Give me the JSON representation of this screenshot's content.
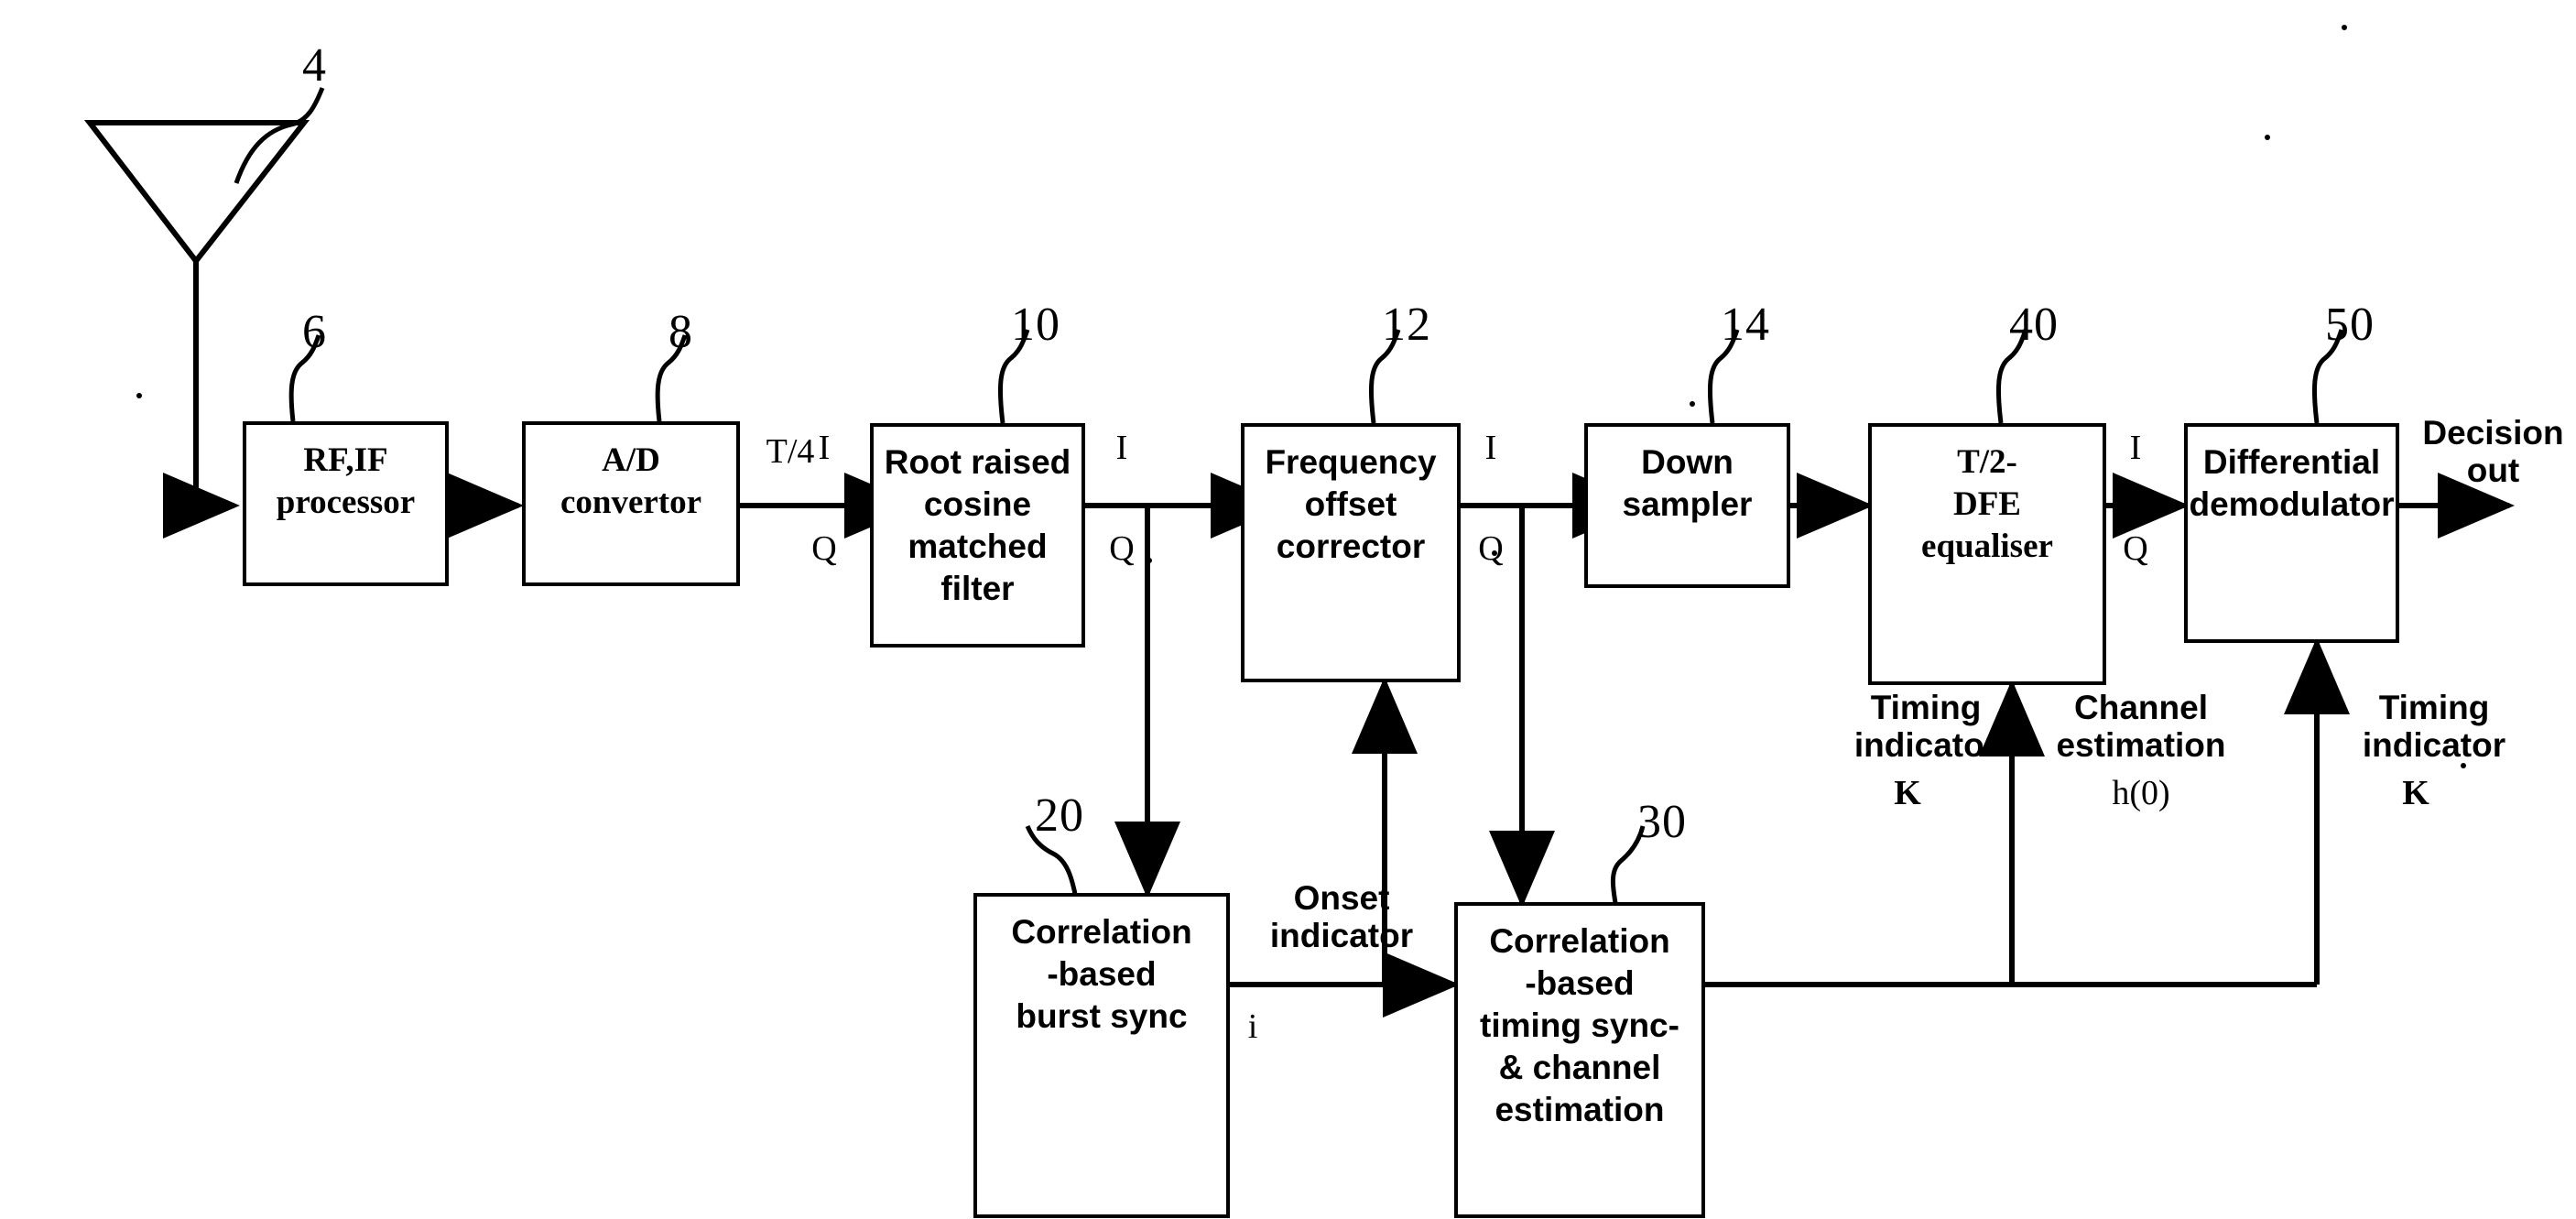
{
  "figure": {
    "kind": "patent-block-diagram",
    "line_color": "#000000",
    "background": "#ffffff"
  },
  "antenna": {
    "name": "antenna",
    "ref": "4"
  },
  "blocks": [
    {
      "id": "rf_if",
      "ref": "6",
      "label": "RF,IF\nprocessor"
    },
    {
      "id": "adc",
      "ref": "8",
      "label": "A/D\nconvertor"
    },
    {
      "id": "rrc",
      "ref": "10",
      "label": "Root raised\ncosine\nmatched\nfilter"
    },
    {
      "id": "foc",
      "ref": "12",
      "label": "Frequency\noffset\ncorrector"
    },
    {
      "id": "dsamp",
      "ref": "14",
      "label": "Down\nsampler"
    },
    {
      "id": "dfe",
      "ref": "40",
      "label": "T/2-\nDFE\nequaliser"
    },
    {
      "id": "ddem",
      "ref": "50",
      "label": "Differential\ndemodulator"
    },
    {
      "id": "bsync",
      "ref": "20",
      "label": "Correlation\n-based\nburst sync"
    },
    {
      "id": "tsync",
      "ref": "30",
      "label": "Correlation\n-based\ntiming sync-\n& channel\nestimation"
    }
  ],
  "signal_labels": {
    "t_over_4": "T/4",
    "i_adc": "I",
    "q_adc": "Q",
    "i_rrc": "I",
    "q_rrc": "Q",
    "i_foc": "I",
    "q_foc": "Q",
    "i_dfe": "I",
    "q_dfe": "Q",
    "decision_out": "Decision\nout",
    "onset_indicator": "Onset\nindicator",
    "onset_symbol": "i",
    "timing_indicator_left": "Timing\nindicator",
    "timing_indicator_left_symbol": "K",
    "channel_estimation": "Channel\nestimation",
    "channel_estimation_symbol": "h(0)",
    "timing_indicator_right": "Timing\nindicator",
    "timing_indicator_right_symbol": "K"
  }
}
